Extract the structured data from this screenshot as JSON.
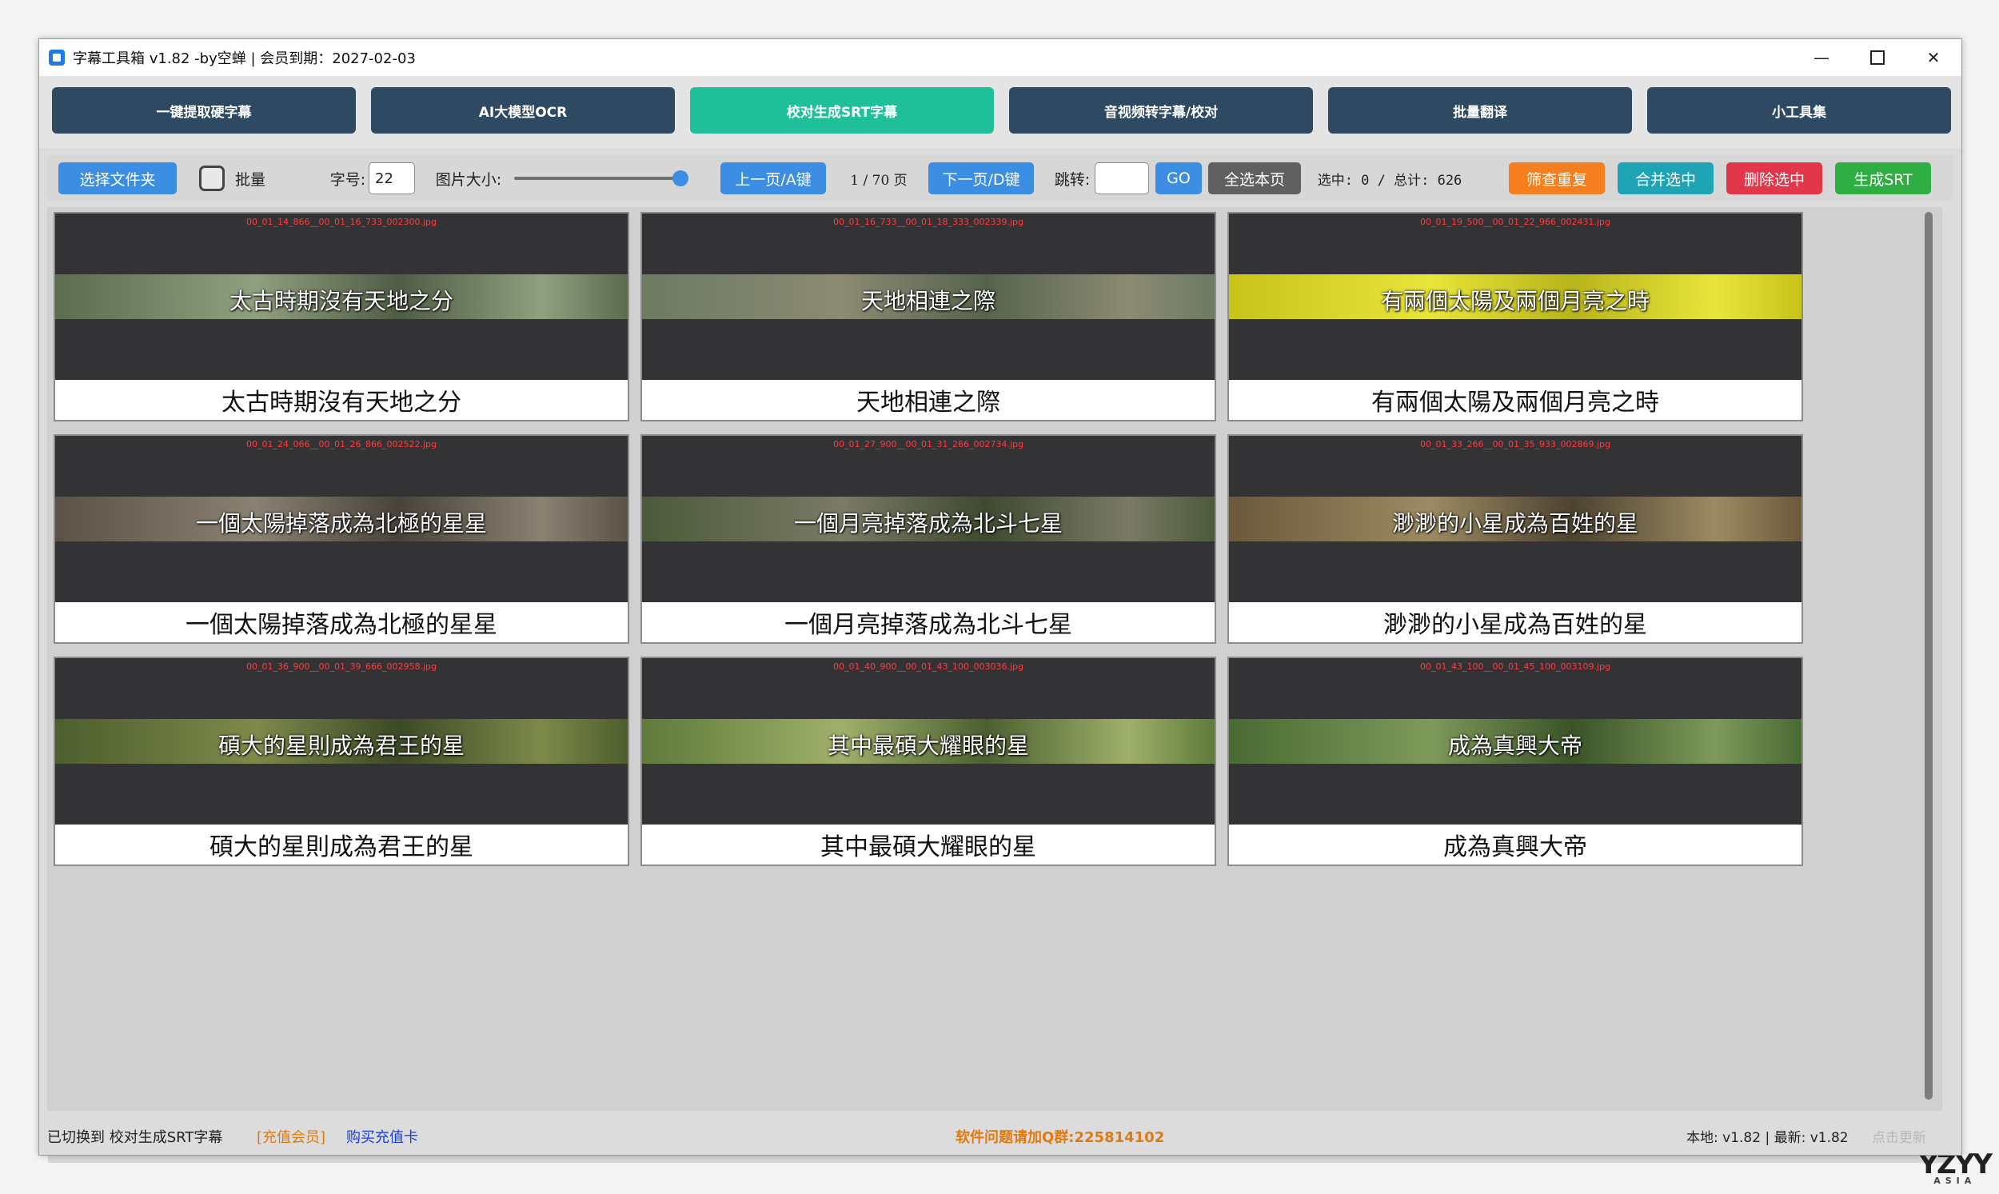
{
  "window": {
    "title": "字幕工具箱 v1.82 -by空蝉 | 会员到期：2027-02-03",
    "minimize": "—",
    "close": "✕"
  },
  "nav": [
    {
      "label": "一键提取硬字幕",
      "active": false
    },
    {
      "label": "AI大模型OCR",
      "active": false
    },
    {
      "label": "校对生成SRT字幕",
      "active": true
    },
    {
      "label": "音视频转字幕/校对",
      "active": false
    },
    {
      "label": "批量翻译",
      "active": false
    },
    {
      "label": "小工具集",
      "active": false
    }
  ],
  "toolbar": {
    "select_folder": "选择文件夹",
    "batch_label": "批量",
    "font_size_label": "字号:",
    "font_size_value": "22",
    "image_size_label": "图片大小:",
    "image_size_level": 1.0,
    "prev_page": "上一页/A键",
    "page_info": "1 / 70 页",
    "next_page": "下一页/D键",
    "jump_label": "跳转:",
    "jump_value": "",
    "go": "GO",
    "select_all_page": "全选本页",
    "selection_info": "选中: 0 / 总计: 626",
    "find_duplicates": "筛查重复",
    "merge_selected": "合并选中",
    "delete_selected": "删除选中",
    "generate_srt": "生成SRT"
  },
  "cards": [
    {
      "file": "00_01_14_866__00_01_16_733_002300.jpg",
      "overlay": "太古時期沒有天地之分",
      "caption": "太古時期沒有天地之分",
      "band_colors": [
        "#5d6b4f",
        "#8fa07f",
        "#4f5d45"
      ]
    },
    {
      "file": "00_01_16_733__00_01_18_333_002339.jpg",
      "overlay": "天地相連之際",
      "caption": "天地相連之際",
      "band_colors": [
        "#6c7b62",
        "#8c8a74",
        "#56634c"
      ]
    },
    {
      "file": "00_01_19_500__00_01_22_966_002431.jpg",
      "overlay": "有兩個太陽及兩個月亮之時",
      "caption": "有兩個太陽及兩個月亮之時",
      "band_colors": [
        "#c9c318",
        "#e8e53a",
        "#b7b51c"
      ]
    },
    {
      "file": "00_01_24_066__00_01_26_866_002522.jpg",
      "overlay": "一個太陽掉落成為北極的星星",
      "caption": "一個太陽掉落成為北極的星星",
      "band_colors": [
        "#5b5248",
        "#8a8172",
        "#4a433b"
      ]
    },
    {
      "file": "00_01_27_900__00_01_31_266_002734.jpg",
      "overlay": "一個月亮掉落成為北斗七星",
      "caption": "一個月亮掉落成為北斗七星",
      "band_colors": [
        "#4c5a3a",
        "#7a7a66",
        "#3e4a30"
      ]
    },
    {
      "file": "00_01_33_266__00_01_35_933_002869.jpg",
      "overlay": "渺渺的小星成為百姓的星",
      "caption": "渺渺的小星成為百姓的星",
      "band_colors": [
        "#6a5a3c",
        "#9c8a62",
        "#4d4330"
      ]
    },
    {
      "file": "00_01_36_900__00_01_39_666_002958.jpg",
      "overlay": "碩大的星則成為君王的星",
      "caption": "碩大的星則成為君王的星",
      "band_colors": [
        "#4d5e2e",
        "#7e8a4a",
        "#3c4a26"
      ]
    },
    {
      "file": "00_01_40_900__00_01_43_100_003036.jpg",
      "overlay": "其中最碩大耀眼的星",
      "caption": "其中最碩大耀眼的星",
      "band_colors": [
        "#5f7a3a",
        "#9fb06a",
        "#4b6030"
      ]
    },
    {
      "file": "00_01_43_100__00_01_45_100_003109.jpg",
      "overlay": "成為真興大帝",
      "caption": "成為真興大帝",
      "band_colors": [
        "#4a6a34",
        "#7d9a5a",
        "#3a5428"
      ]
    }
  ],
  "status": {
    "switched": "已切换到 校对生成SRT字幕",
    "recharge": "[充值会员]",
    "buy_card": "购买充值卡",
    "support": "软件问题请加Q群:225814102",
    "version": "本地: v1.82 | 最新: v1.82",
    "update": "点击更新"
  },
  "brand": {
    "logo": "YZYY",
    "sub": "ASIA"
  }
}
